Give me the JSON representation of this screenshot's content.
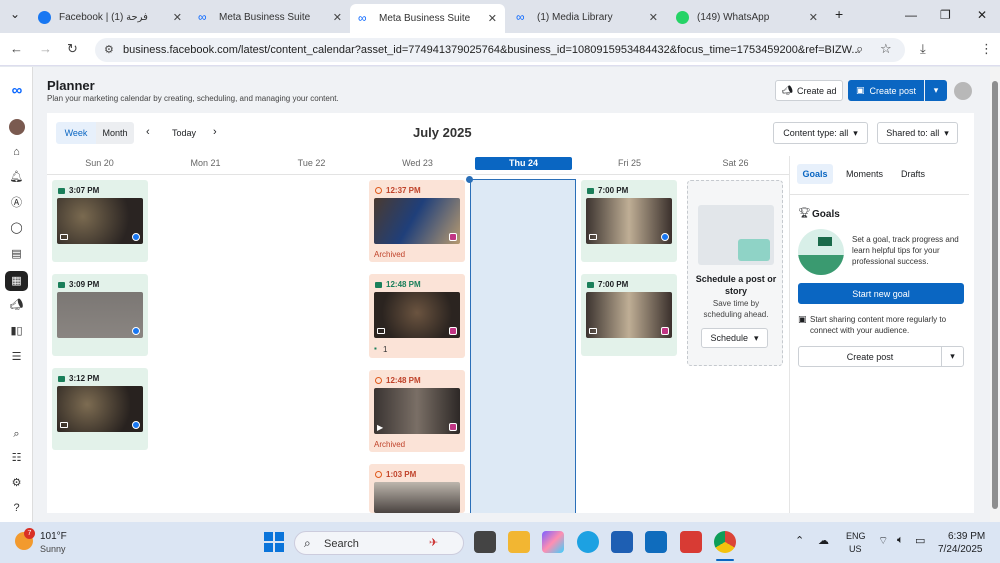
{
  "browser": {
    "tabs": [
      {
        "label": "Facebook | فرحة (1)",
        "active": false
      },
      {
        "label": "Meta Business Suite",
        "active": false
      },
      {
        "label": "Meta Business Suite",
        "active": true
      },
      {
        "label": "(1) Media Library",
        "active": false
      },
      {
        "label": "(149) WhatsApp",
        "active": false
      }
    ],
    "url": "business.facebook.com/latest/content_calendar?asset_id=774941379025764&business_id=1080915953484432&focus_time=1753459200&ref=BIZW..."
  },
  "planner": {
    "title": "Planner",
    "subtitle": "Plan your marketing calendar by creating, scheduling, and managing your content.",
    "create_ad": "Create ad",
    "create_post": "Create post"
  },
  "toolbar": {
    "week": "Week",
    "month": "Month",
    "today": "Today",
    "month_title": "July 2025",
    "content_type": "Content type: all",
    "shared_to": "Shared to: all"
  },
  "days": [
    "Sun 20",
    "Mon 21",
    "Tue 22",
    "Wed 23",
    "Thu 24",
    "Fri 25",
    "Sat 26"
  ],
  "posts": {
    "sun": [
      {
        "time": "3:07 PM"
      },
      {
        "time": "3:09 PM"
      },
      {
        "time": "3:12 PM"
      }
    ],
    "wed": [
      {
        "time": "12:37 PM",
        "status": "Archived"
      },
      {
        "time": "12:48 PM",
        "comments": "1"
      },
      {
        "time": "12:48 PM",
        "status": "Archived"
      },
      {
        "time": "1:03 PM"
      }
    ],
    "fri": [
      {
        "time": "7:00 PM"
      },
      {
        "time": "7:00 PM"
      }
    ]
  },
  "schedule_card": {
    "title": "Schedule a post or story",
    "body": "Save time by scheduling ahead.",
    "button": "Schedule"
  },
  "side": {
    "tabs": [
      "Goals",
      "Moments",
      "Drafts"
    ],
    "goals_title": "Goals",
    "goals_text": "Set a goal, track progress and learn helpful tips for your professional success.",
    "start_goal": "Start new goal",
    "share_text": "Start sharing content more regularly to connect with your audience.",
    "create_post": "Create post"
  },
  "taskbar": {
    "temp": "101°F",
    "weather": "Sunny",
    "badge": "7",
    "search": "Search",
    "lang1": "ENG",
    "lang2": "US",
    "time": "6:39 PM",
    "date": "7/24/2025"
  }
}
